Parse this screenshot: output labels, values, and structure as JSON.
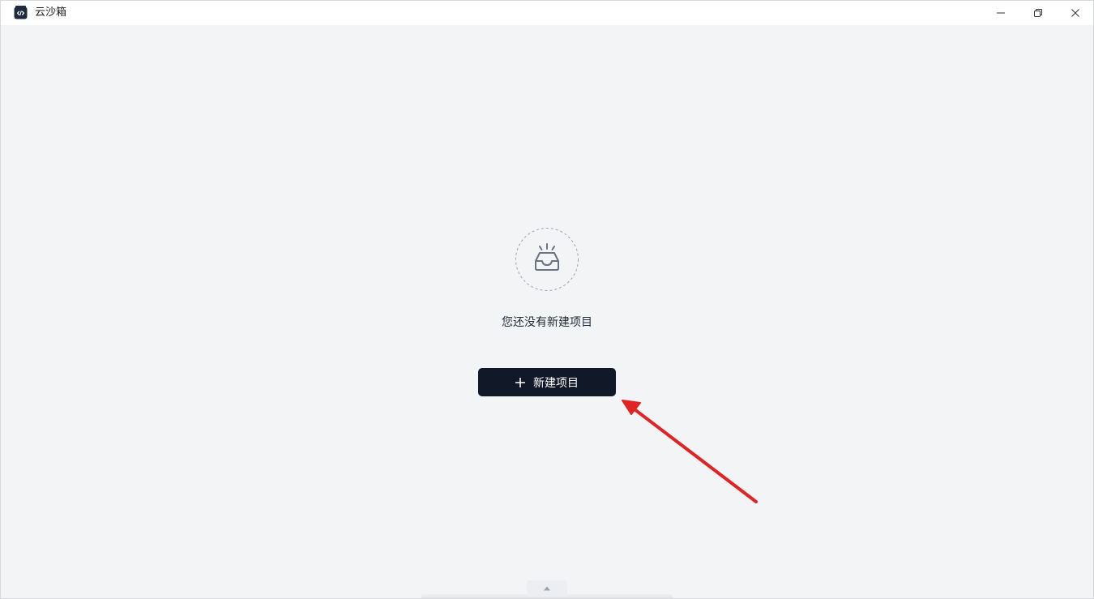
{
  "window": {
    "title": "云沙箱",
    "icons": {
      "app": "code-box-icon",
      "minimize": "minimize-icon",
      "maximize": "restore-icon",
      "close": "close-icon"
    }
  },
  "empty_state": {
    "icon": "inbox-icon",
    "message": "您还没有新建项目"
  },
  "actions": {
    "new_project_label": "新建项目",
    "new_project_icon": "plus-icon"
  },
  "bottom_panel": {
    "toggle_icon": "caret-up-icon"
  },
  "colors": {
    "background": "#f3f4f6",
    "titlebar": "#ffffff",
    "primary_button": "#111827",
    "annotation_arrow": "#e02424"
  }
}
